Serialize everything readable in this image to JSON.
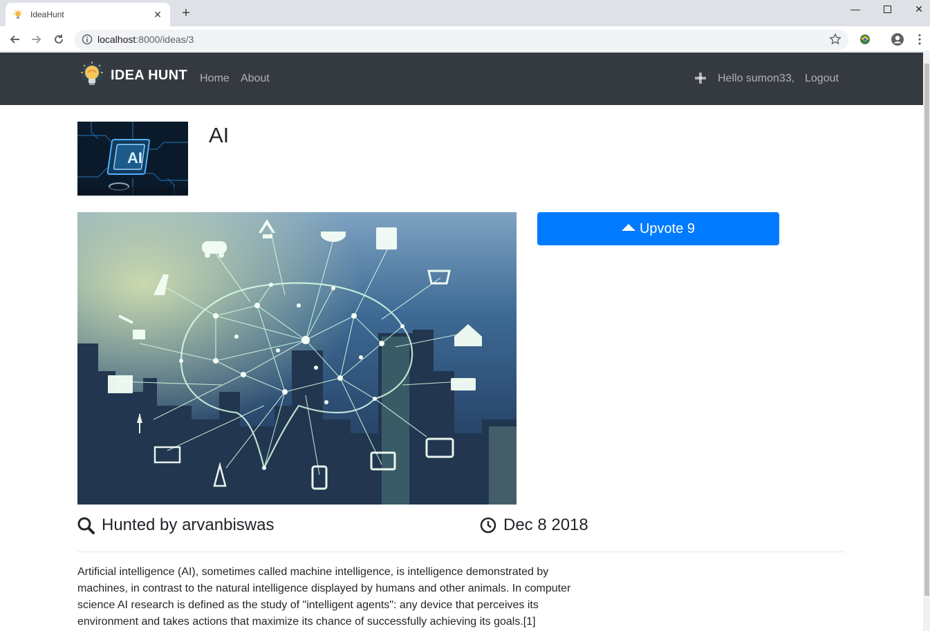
{
  "browser": {
    "tab_title": "IdeaHunt",
    "url_host": "localhost",
    "url_path": ":8000/ideas/3"
  },
  "nav": {
    "brand": "IDEA HUNT",
    "links": [
      "Home",
      "About"
    ],
    "greeting": "Hello sumon33,",
    "logout": "Logout"
  },
  "idea": {
    "title": "AI",
    "upvote_label": "Upvote 9",
    "hunted_by": "Hunted by arvanbiswas",
    "date": "Dec 8 2018",
    "description": "Artificial intelligence (AI), sometimes called machine intelligence, is intelligence demonstrated by machines, in contrast to the natural intelligence displayed by humans and other animals. In computer science AI research is defined as the study of \"intelligent agents\": any device that perceives its environment and takes actions that maximize its chance of successfully achieving its goals.[1]"
  },
  "colors": {
    "navbar": "#343a40",
    "primary": "#007bff"
  },
  "icons": {
    "hunted": "search-icon",
    "date": "clock-icon",
    "add": "plus-icon",
    "upvote": "triangle-up-icon"
  }
}
